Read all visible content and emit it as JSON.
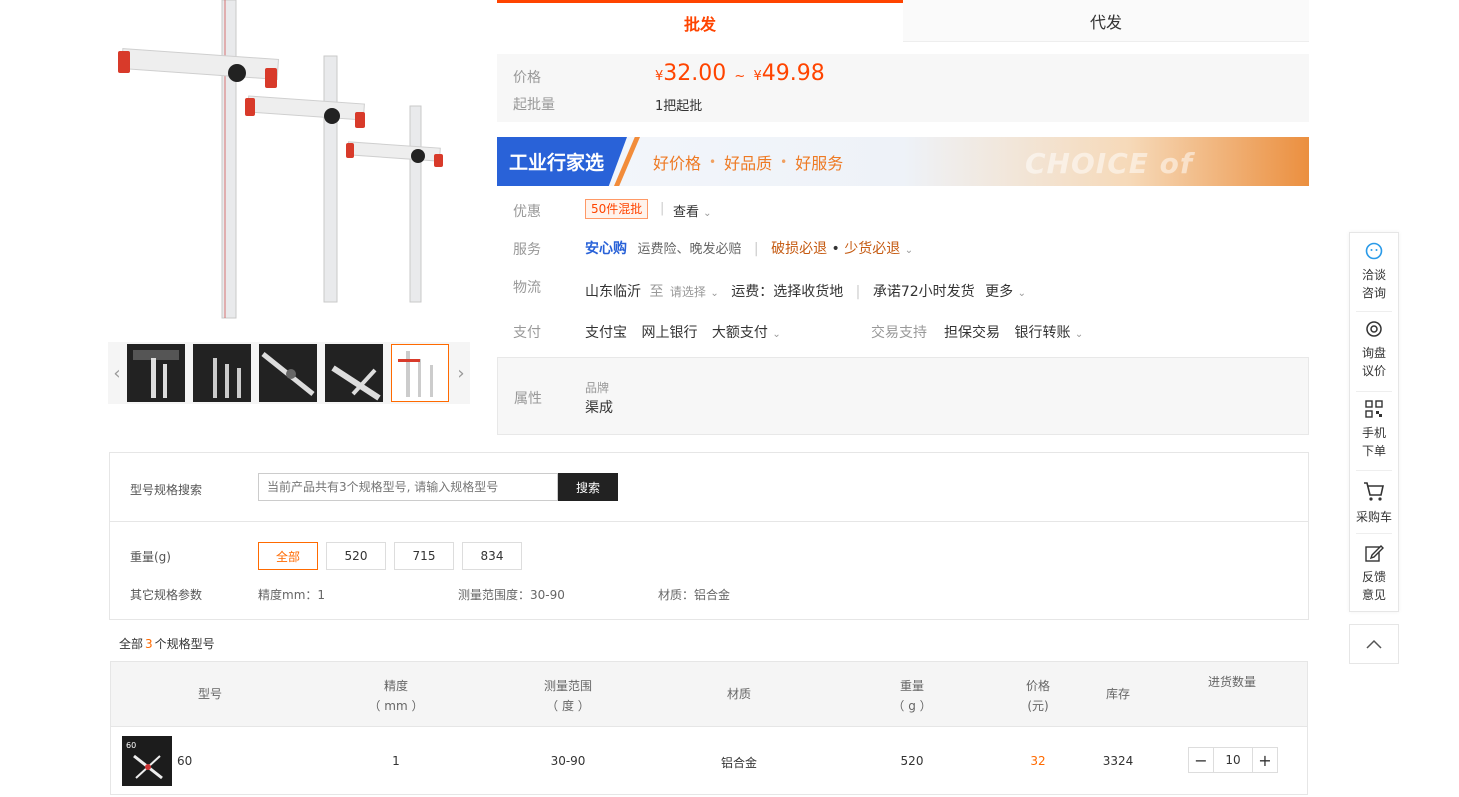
{
  "tabs": {
    "wholesale": "批发",
    "dropship": "代发"
  },
  "price": {
    "label": "价格",
    "currency": "¥",
    "min": "32.00",
    "range_sep": "~",
    "max": "49.98",
    "moq_label": "起批量",
    "moq_value": "1把起批"
  },
  "banner": {
    "title": "工业行家选",
    "slogan_1": "好价格",
    "slogan_2": "好品质",
    "slogan_3": "好服务",
    "dot": "•",
    "watermark": "CHOICE of EXPERT"
  },
  "promo": {
    "label": "优惠",
    "badge": "50件混批",
    "view": "查看"
  },
  "service": {
    "label": "服务",
    "brand": "安心购",
    "desc": "运费险、晚发必赔",
    "refund_1": "破损必退",
    "dot": "•",
    "refund_2": "少货必退"
  },
  "logistics": {
    "label": "物流",
    "origin": "山东临沂",
    "to": "至",
    "select": "请选择",
    "freight": "运费：选择收货地",
    "promise": "承诺72小时发货",
    "more": "更多"
  },
  "payment": {
    "label": "支付",
    "methods": [
      "支付宝",
      "网上银行",
      "大额支付"
    ],
    "trade_label": "交易支持",
    "trade_methods": [
      "担保交易",
      "银行转账"
    ]
  },
  "attributes": {
    "label": "属性",
    "brand_label": "品牌",
    "brand_value": "渠成"
  },
  "spec_search": {
    "label": "型号规格搜索",
    "placeholder": "当前产品共有3个规格型号, 请输入规格型号",
    "button": "搜索"
  },
  "weight": {
    "label": "重量(g)",
    "options": [
      "全部",
      "520",
      "715",
      "834"
    ],
    "selected": "全部"
  },
  "other_specs": {
    "label": "其它规格参数",
    "items": [
      "精度mm：1",
      "测量范围度：30-90",
      "材质：铝合金"
    ]
  },
  "summary": {
    "prefix": "全部",
    "count": "3",
    "suffix": "个规格型号"
  },
  "table": {
    "headers": {
      "model": "型号",
      "precision": "精度",
      "precision_unit": "（ mm ）",
      "range": "测量范围",
      "range_unit": "（ 度 ）",
      "material": "材质",
      "weight": "重量",
      "weight_unit": "（ g ）",
      "price": "价格",
      "price_unit": "(元)",
      "stock": "库存",
      "qty": "进货数量"
    },
    "rows": [
      {
        "model": "60",
        "precision": "1",
        "range": "30-90",
        "material": "铝合金",
        "weight": "520",
        "price": "32",
        "stock": "3324",
        "qty": "10"
      }
    ]
  },
  "sidebar": {
    "chat": [
      "洽谈",
      "咨询"
    ],
    "quote": [
      "询盘",
      "议价"
    ],
    "mobile": [
      "手机",
      "下单"
    ],
    "cart": "采购车",
    "feedback": [
      "反馈",
      "意见"
    ]
  },
  "colors": {
    "accent": "#ff4400",
    "orange": "#ff6a00",
    "blue": "#2962d8"
  }
}
